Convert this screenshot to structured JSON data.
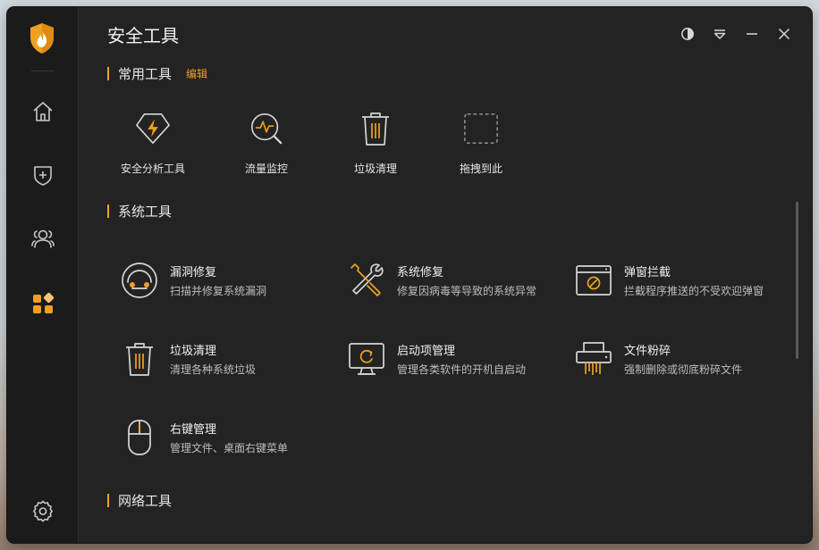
{
  "window": {
    "title": "安全工具"
  },
  "colors": {
    "accent": "#f0a020",
    "background": "#232323",
    "sidebar": "#1b1b1b"
  },
  "sidebar": {
    "items": [
      {
        "icon": "home-icon"
      },
      {
        "icon": "shield-plus-icon"
      },
      {
        "icon": "users-icon"
      },
      {
        "icon": "apps-grid-icon",
        "active": true
      }
    ],
    "bottom_icon": "settings-icon"
  },
  "common_tools": {
    "title": "常用工具",
    "edit_label": "编辑",
    "items": [
      {
        "label": "安全分析工具",
        "icon": "security-analysis-icon"
      },
      {
        "label": "流量监控",
        "icon": "traffic-monitor-icon"
      },
      {
        "label": "垃圾清理",
        "icon": "trash-icon"
      },
      {
        "label": "拖拽到此",
        "icon": "drop-placeholder-icon"
      }
    ]
  },
  "system_tools": {
    "title": "系统工具",
    "items": [
      {
        "name": "漏洞修复",
        "desc": "扫描并修复系统漏洞",
        "icon": "vulnerability-repair-icon"
      },
      {
        "name": "系统修复",
        "desc": "修复因病毒等导致的系统异常",
        "icon": "tools-wrench-icon"
      },
      {
        "name": "弹窗拦截",
        "desc": "拦截程序推送的不受欢迎弹窗",
        "icon": "popup-block-icon"
      },
      {
        "name": "垃圾清理",
        "desc": "清理各种系统垃圾",
        "icon": "trash-icon"
      },
      {
        "name": "启动项管理",
        "desc": "管理各类软件的开机自启动",
        "icon": "startup-monitor-icon"
      },
      {
        "name": "文件粉碎",
        "desc": "强制删除或彻底粉碎文件",
        "icon": "shredder-icon"
      },
      {
        "name": "右键管理",
        "desc": "管理文件、桌面右键菜单",
        "icon": "mouse-icon"
      }
    ]
  },
  "network_tools": {
    "title": "网络工具"
  }
}
